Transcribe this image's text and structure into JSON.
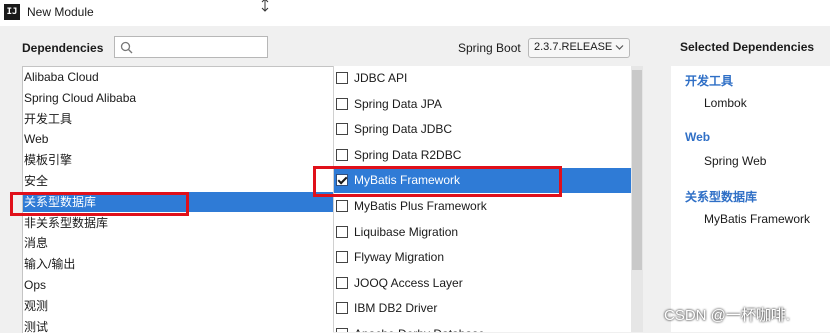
{
  "window": {
    "title": "New Module",
    "app_icon": "IJ"
  },
  "search": {
    "label": "Dependencies",
    "placeholder": ""
  },
  "spring_boot": {
    "label": "Spring Boot",
    "version": "2.3.7.RELEASE"
  },
  "categories": [
    {
      "label": "Alibaba Cloud",
      "selected": false
    },
    {
      "label": "Spring Cloud Alibaba",
      "selected": false
    },
    {
      "label": "开发工具",
      "selected": false
    },
    {
      "label": "Web",
      "selected": false
    },
    {
      "label": "模板引擎",
      "selected": false
    },
    {
      "label": "安全",
      "selected": false
    },
    {
      "label": "关系型数据库",
      "selected": true
    },
    {
      "label": "非关系型数据库",
      "selected": false
    },
    {
      "label": "消息",
      "selected": false
    },
    {
      "label": "输入/输出",
      "selected": false
    },
    {
      "label": "Ops",
      "selected": false
    },
    {
      "label": "观测",
      "selected": false
    },
    {
      "label": "测试",
      "selected": false
    }
  ],
  "dependencies": [
    {
      "label": "JDBC API",
      "checked": false,
      "selected": false
    },
    {
      "label": "Spring Data JPA",
      "checked": false,
      "selected": false
    },
    {
      "label": "Spring Data JDBC",
      "checked": false,
      "selected": false
    },
    {
      "label": "Spring Data R2DBC",
      "checked": false,
      "selected": false
    },
    {
      "label": "MyBatis Framework",
      "checked": true,
      "selected": true
    },
    {
      "label": "MyBatis Plus Framework",
      "checked": false,
      "selected": false
    },
    {
      "label": "Liquibase Migration",
      "checked": false,
      "selected": false
    },
    {
      "label": "Flyway Migration",
      "checked": false,
      "selected": false
    },
    {
      "label": "JOOQ Access Layer",
      "checked": false,
      "selected": false
    },
    {
      "label": "IBM DB2 Driver",
      "checked": false,
      "selected": false
    },
    {
      "label": "Apache Derby Database",
      "checked": false,
      "selected": false
    }
  ],
  "selected_dependencies": {
    "title": "Selected Dependencies",
    "groups": [
      {
        "name": "开发工具",
        "items": [
          "Lombok"
        ]
      },
      {
        "name": "Web",
        "items": [
          "Spring Web"
        ]
      },
      {
        "name": "关系型数据库",
        "items": [
          "MyBatis Framework"
        ]
      }
    ]
  },
  "watermark": "CSDN @一杯咖啡.",
  "colors": {
    "selection": "#2f7bd6",
    "group_title": "#2f6fc6",
    "highlight": "#e0101a"
  }
}
